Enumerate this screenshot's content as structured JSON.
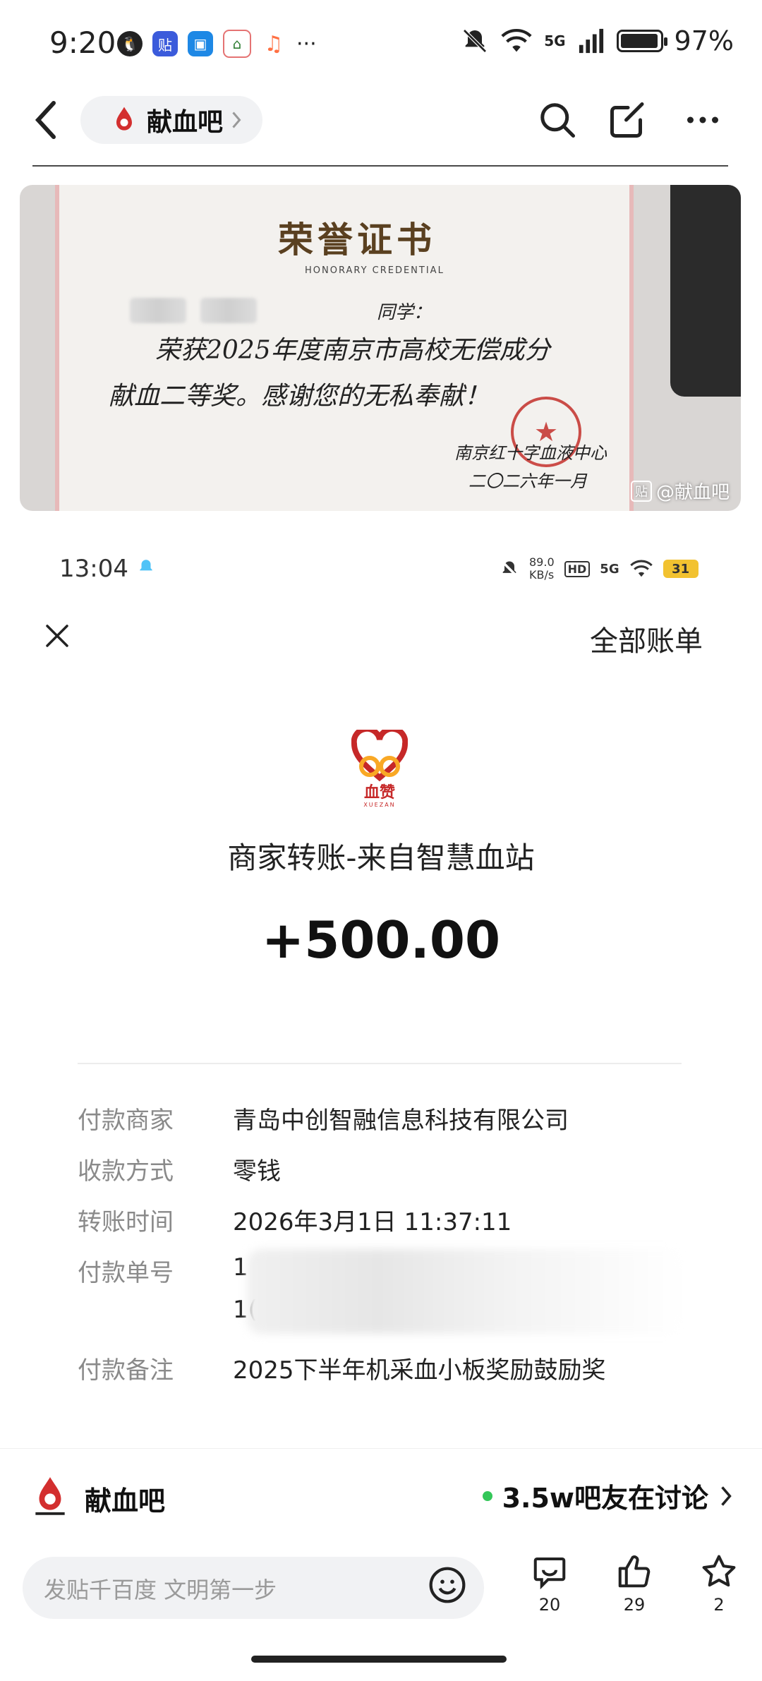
{
  "status_bar": {
    "time": "9:20",
    "more": "···",
    "network": "5G",
    "signal_bars": "7",
    "battery": "97%",
    "battery_level": 0.97
  },
  "nav": {
    "forum_name": "献血吧",
    "back_icon": "chevron-left-icon",
    "search_icon": "search-icon",
    "edit_icon": "edit-icon",
    "more_icon": "more-icon"
  },
  "certificate_photo": {
    "title": "荣誉证书",
    "subtitle": "HONORARY CREDENTIAL",
    "greeting": "同学：",
    "line1": "荣获2025年度南京市高校无偿成分",
    "line2": "献血二等奖。感谢您的无私奉献！",
    "issuer": "南京红十字血液中心",
    "date": "二〇二六年一月",
    "watermark": "@献血吧"
  },
  "inner_status": {
    "time": "13:04",
    "speed_top": "89.0",
    "speed_bottom": "KB/s",
    "hd": "HD",
    "network": "5G",
    "battery": "31"
  },
  "bill": {
    "all_bills": "全部账单",
    "logo_text": "血赞",
    "logo_sub": "XUEZAN",
    "merchant_title": "商家转账-来自智慧血站",
    "amount": "+500.00",
    "rows": [
      {
        "label": "付款商家",
        "value": "青岛中创智融信息科技有限公司"
      },
      {
        "label": "收款方式",
        "value": "零钱"
      },
      {
        "label": "转账时间",
        "value": "2026年3月1日 11:37:11"
      },
      {
        "label": "付款单号",
        "value": "1",
        "value2": "1("
      },
      {
        "label": "付款备注",
        "value": "2025下半年机采血小板奖励鼓励奖"
      }
    ]
  },
  "forum_bar": {
    "name": "献血吧",
    "discussing": "3.5w吧友在讨论"
  },
  "bottom": {
    "compose_placeholder": "发贴千百度 文明第一步",
    "comment_count": "20",
    "like_count": "29",
    "star_count": "2"
  },
  "colors": {
    "accent_green": "#34c759",
    "brand_red": "#c4302b"
  }
}
